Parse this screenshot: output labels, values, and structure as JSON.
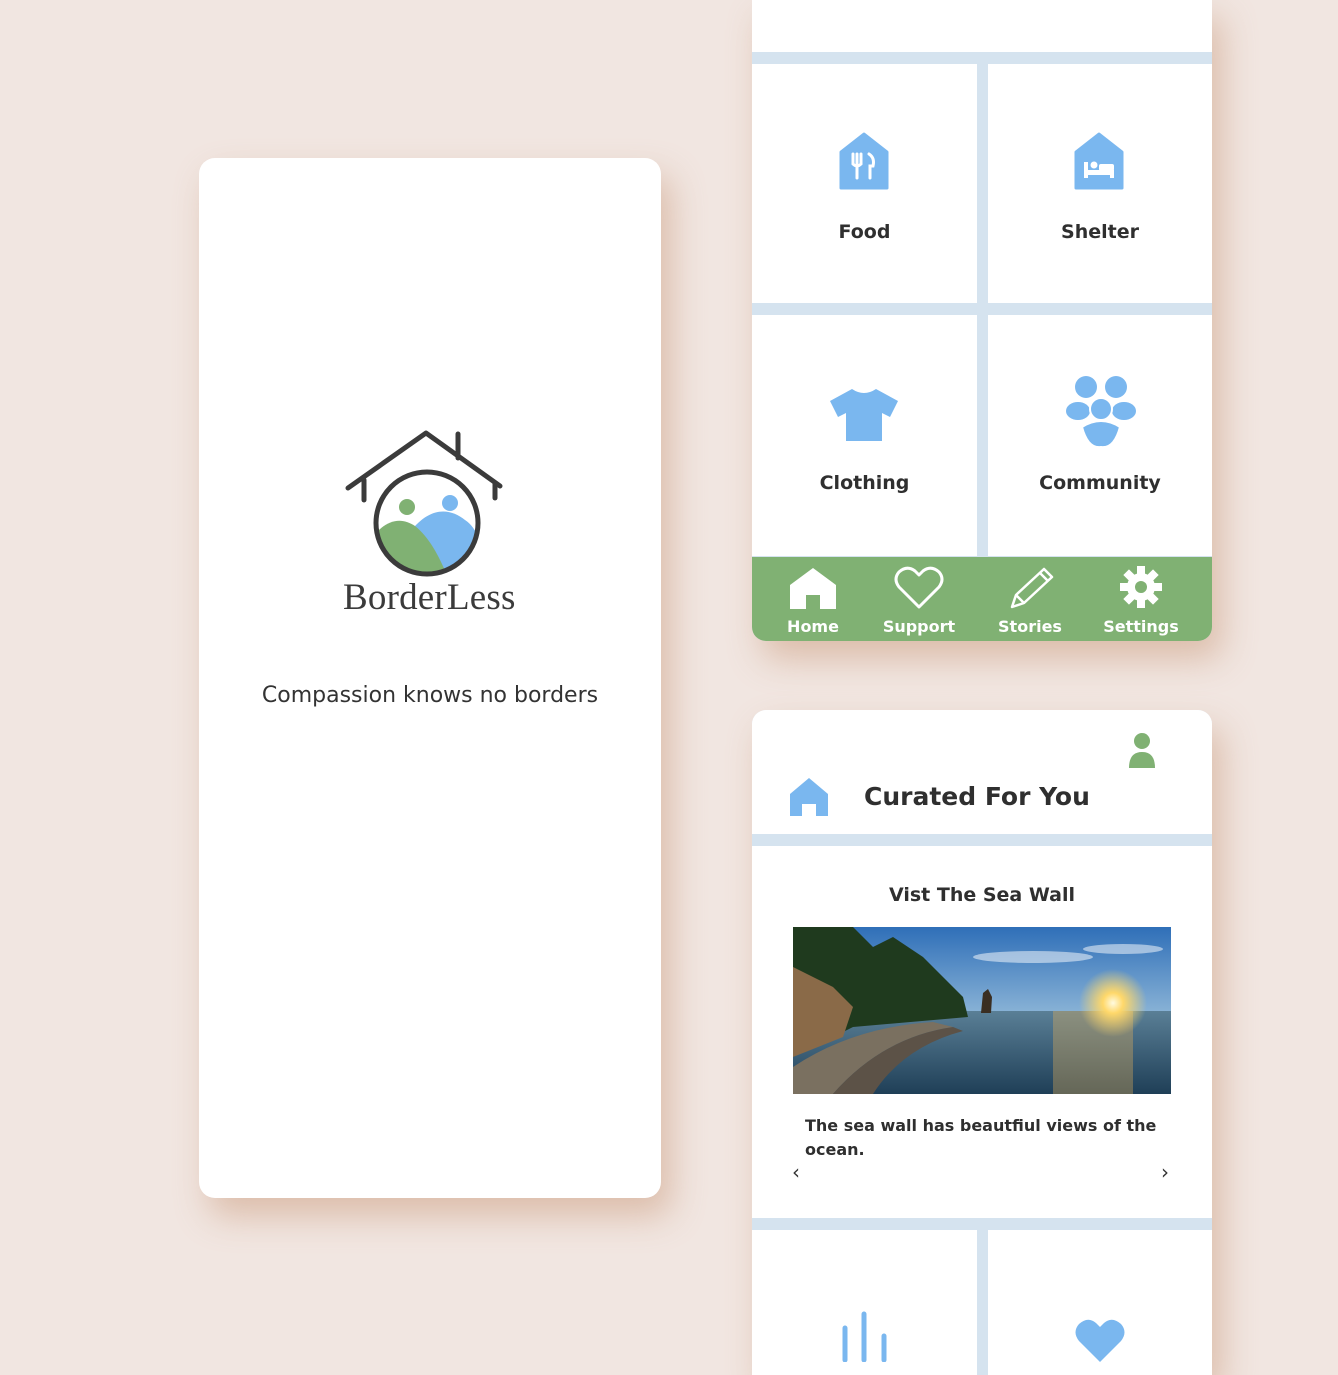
{
  "splash": {
    "brand": "BorderLess",
    "tagline": "Compassion knows no borders"
  },
  "categories": {
    "tiles": [
      {
        "label": "Food",
        "icon": "food-house-icon"
      },
      {
        "label": "Shelter",
        "icon": "shelter-house-icon"
      },
      {
        "label": "Clothing",
        "icon": "tshirt-icon"
      },
      {
        "label": "Community",
        "icon": "community-people-icon"
      }
    ]
  },
  "nav": {
    "items": [
      {
        "label": "Home",
        "icon": "home-icon"
      },
      {
        "label": "Support",
        "icon": "heart-outline-icon"
      },
      {
        "label": "Stories",
        "icon": "pencil-icon"
      },
      {
        "label": "Settings",
        "icon": "gear-icon"
      }
    ]
  },
  "curated": {
    "title": "Curated For You",
    "story": {
      "title": "Vist The Sea Wall",
      "description": "The sea wall has beautfiul views of the ocean.",
      "prev": "‹",
      "next": "›"
    }
  },
  "colors": {
    "background": "#f1e6e1",
    "accent_blue": "#7ab7ef",
    "accent_green": "#80b173",
    "divider": "#d5e3ef",
    "logo_dark": "#3b3b3b"
  }
}
